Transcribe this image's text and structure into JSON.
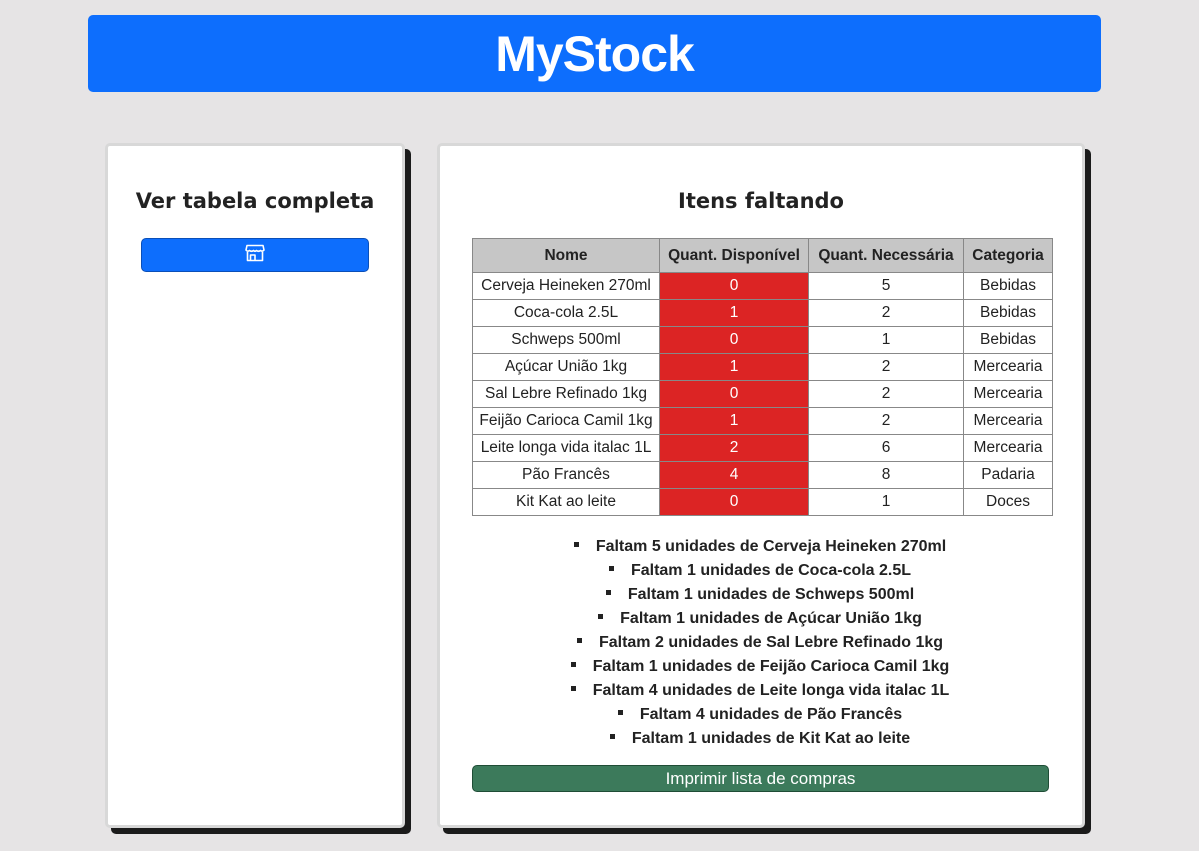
{
  "app": {
    "title": "MyStock"
  },
  "sidebar": {
    "title": "Ver tabela completa",
    "button_icon": "store-icon"
  },
  "main": {
    "title": "Itens faltando",
    "table": {
      "headers": [
        "Nome",
        "Quant. Disponível",
        "Quant. Necessária",
        "Categoria"
      ],
      "rows": [
        {
          "nome": "Cerveja Heineken 270ml",
          "disponivel": "0",
          "necessaria": "5",
          "categoria": "Bebidas"
        },
        {
          "nome": "Coca-cola 2.5L",
          "disponivel": "1",
          "necessaria": "2",
          "categoria": "Bebidas"
        },
        {
          "nome": "Schweps 500ml",
          "disponivel": "0",
          "necessaria": "1",
          "categoria": "Bebidas"
        },
        {
          "nome": "Açúcar União 1kg",
          "disponivel": "1",
          "necessaria": "2",
          "categoria": "Mercearia"
        },
        {
          "nome": "Sal Lebre Refinado 1kg",
          "disponivel": "0",
          "necessaria": "2",
          "categoria": "Mercearia"
        },
        {
          "nome": "Feijão Carioca Camil 1kg",
          "disponivel": "1",
          "necessaria": "2",
          "categoria": "Mercearia"
        },
        {
          "nome": "Leite longa vida italac 1L",
          "disponivel": "2",
          "necessaria": "6",
          "categoria": "Mercearia"
        },
        {
          "nome": "Pão Francês",
          "disponivel": "4",
          "necessaria": "8",
          "categoria": "Padaria"
        },
        {
          "nome": "Kit Kat ao leite",
          "disponivel": "0",
          "necessaria": "1",
          "categoria": "Doces"
        }
      ]
    },
    "faltas": [
      "Faltam 5 unidades de Cerveja Heineken 270ml",
      "Faltam 1 unidades de Coca-cola 2.5L",
      "Faltam 1 unidades de Schweps 500ml",
      "Faltam 1 unidades de Açúcar União 1kg",
      "Faltam 2 unidades de Sal Lebre Refinado 1kg",
      "Faltam 1 unidades de Feijão Carioca Camil 1kg",
      "Faltam 4 unidades de Leite longa vida italac 1L",
      "Faltam 4 unidades de Pão Francês",
      "Faltam 1 unidades de Kit Kat ao leite"
    ],
    "print_button": "Imprimir lista de compras"
  },
  "colors": {
    "header": "#0d6efd",
    "low_stock": "#dc2424",
    "print_button": "#3c7a5b",
    "background": "#e6e4e5"
  }
}
